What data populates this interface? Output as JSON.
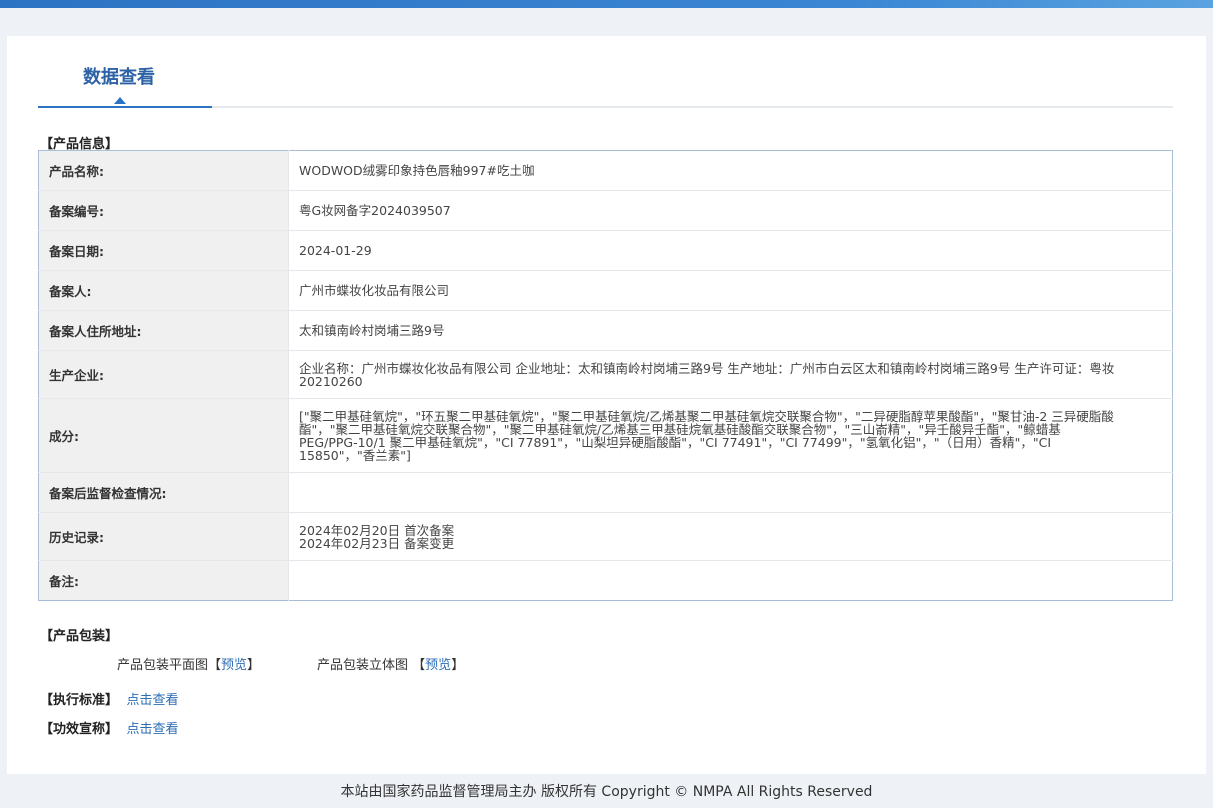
{
  "tab": {
    "title": "数据查看"
  },
  "product_info": {
    "section_title": "【产品信息】",
    "rows": [
      {
        "label": "产品名称:",
        "value": "WODWOD绒雾印象持色唇釉997#吃土咖"
      },
      {
        "label": "备案编号:",
        "value": "粤G妆网备字2024039507"
      },
      {
        "label": "备案日期:",
        "value": "2024-01-29"
      },
      {
        "label": "备案人:",
        "value": "广州市蝶妆化妆品有限公司"
      },
      {
        "label": "备案人住所地址:",
        "value": "太和镇南岭村岗埔三路9号"
      },
      {
        "label": "生产企业:",
        "value": "企业名称：广州市蝶妆化妆品有限公司 企业地址：太和镇南岭村岗埔三路9号 生产地址：广州市白云区太和镇南岭村岗埔三路9号 生产许可证：粤妆20210260"
      },
      {
        "label": "成分:",
        "value": "[\"聚二甲基硅氧烷\"，\"环五聚二甲基硅氧烷\"，\"聚二甲基硅氧烷/乙烯基聚二甲基硅氧烷交联聚合物\"，\"二异硬脂醇苹果酸酯\"，\"聚甘油-2 三异硬脂酸酯\"，\"聚二甲基硅氧烷交联聚合物\"，\"聚二甲基硅氧烷/乙烯基三甲基硅烷氧基硅酸酯交联聚合物\"，\"三山嵛精\"，\"异壬酸异壬酯\"，\"鲸蜡基 PEG/PPG-10/1 聚二甲基硅氧烷\"，\"CI 77891\"，\"山梨坦异硬脂酸酯\"，\"CI 77491\"，\"CI 77499\"，\"氢氧化铝\"，\"（日用）香精\"，\"CI 15850\"，\"香兰素\"]"
      },
      {
        "label": "备案后监督检查情况:",
        "value": ""
      },
      {
        "label": "历史记录:",
        "value": "2024年02月20日 首次备案\n2024年02月23日 备案变更"
      },
      {
        "label": "备注:",
        "value": ""
      }
    ]
  },
  "packaging": {
    "section_title": "【产品包装】",
    "flat_label": "产品包装平面图",
    "flat_link": "预览",
    "three_d_label": "产品包装立体图",
    "three_d_link": "预览",
    "bracket_open": "【",
    "bracket_close": "】"
  },
  "standard": {
    "label": "【执行标准】",
    "link": "点击查看"
  },
  "efficacy": {
    "label": "【功效宣称】",
    "link": "点击查看"
  },
  "footer": {
    "text": "本站由国家药品监督管理局主办 版权所有 Copyright © NMPA All Rights Reserved"
  },
  "colors": {
    "accent": "#2d73c3",
    "title": "#2d63a6",
    "link": "#2b6db5",
    "table_border": "#a9bdd8"
  }
}
